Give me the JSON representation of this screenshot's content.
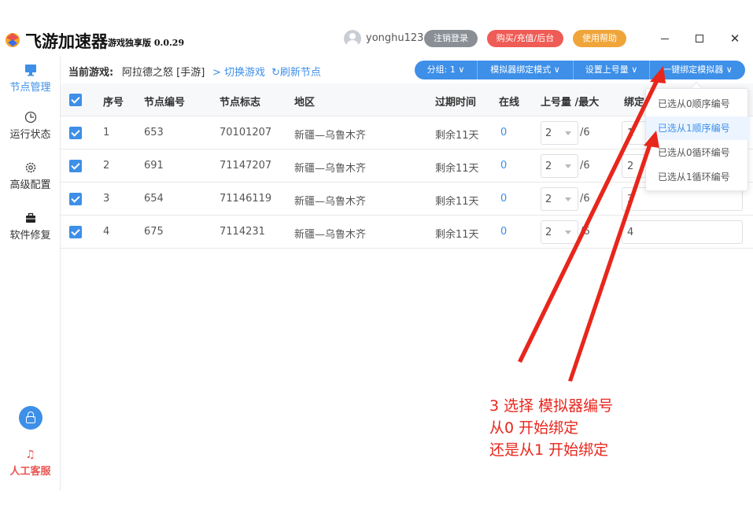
{
  "app": {
    "title": "飞游加速器",
    "subtitle": "游戏独享版 0.0.29",
    "username": "yonghu123",
    "logout_label": "注销登录",
    "buy_label": "购买/充值/后台",
    "help_label": "使用帮助",
    "win_close": "✕"
  },
  "sidebar": {
    "items": [
      {
        "label": "节点管理",
        "icon": "monitor-icon"
      },
      {
        "label": "运行状态",
        "icon": "clock-icon"
      },
      {
        "label": "高级配置",
        "icon": "gear-icon"
      },
      {
        "label": "软件修复",
        "icon": "toolbox-icon"
      }
    ],
    "support_label": "人工客服",
    "support_icon": "♫"
  },
  "toolbar": {
    "current_game_label": "当前游戏:",
    "current_game": "阿拉德之怒 [手游]",
    "switch_game": "切换游戏",
    "refresh_nodes": "刷新节点",
    "group_btn": "分组: 1 ∨",
    "bind_mode_btn": "模拟器绑定模式 ∨",
    "set_number_btn": "设置上号量 ∨",
    "one_key_bind_btn": "一键绑定模拟器 ∨"
  },
  "table": {
    "headers": {
      "index": "序号",
      "node_number": "节点编号",
      "node_tag": "节点标志",
      "region": "地区",
      "expire": "过期时间",
      "online": "在线",
      "count_max": "上号量 /最大",
      "bind": "绑定"
    },
    "rows": [
      {
        "index": "1",
        "node_number": "653",
        "node_tag": "70101207",
        "region": "新疆—乌鲁木齐",
        "expire": "剩余11天",
        "online": "0",
        "count": "2",
        "max": "/6",
        "bind": "1"
      },
      {
        "index": "2",
        "node_number": "691",
        "node_tag": "71147207",
        "region": "新疆—乌鲁木齐",
        "expire": "剩余11天",
        "online": "0",
        "count": "2",
        "max": "/6",
        "bind": "2"
      },
      {
        "index": "3",
        "node_number": "654",
        "node_tag": "71146119",
        "region": "新疆—乌鲁木齐",
        "expire": "剩余11天",
        "online": "0",
        "count": "2",
        "max": "/6",
        "bind": "3"
      },
      {
        "index": "4",
        "node_number": "675",
        "node_tag": "7114231",
        "region": "新疆—乌鲁木齐",
        "expire": "剩余11天",
        "online": "0",
        "count": "2",
        "max": "/6",
        "bind": "4"
      }
    ]
  },
  "dropdown": {
    "options": [
      "已选从0顺序编号",
      "已选从1顺序编号",
      "已选从0循环编号",
      "已选从1循环编号"
    ],
    "highlighted_index": 1
  },
  "annotation": {
    "line1": "3 选择 模拟器编号",
    "line2": "从0 开始绑定",
    "line3": "还是从1 开始绑定",
    "color": "#e8261c"
  }
}
